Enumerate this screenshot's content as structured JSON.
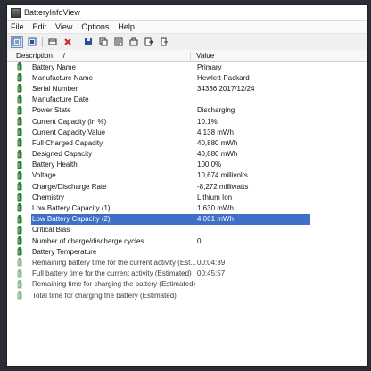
{
  "window": {
    "title": "BatteryInfoView"
  },
  "menu": [
    "File",
    "Edit",
    "View",
    "Options",
    "Help"
  ],
  "toolbar": {
    "icons": [
      "properties-icon",
      "delete-icon",
      "refresh-icon",
      "close-icon",
      "save-icon",
      "copy-icon",
      "report-icon",
      "options-icon",
      "export-icon",
      "exit-icon"
    ]
  },
  "columns": {
    "description": "Description",
    "sort": "/",
    "value": "Value"
  },
  "colors": {
    "selection": "#3f6fc6",
    "battery_green": "#2f7d32"
  },
  "rows": [
    {
      "description": "Battery Name",
      "value": "Primary"
    },
    {
      "description": "Manufacture Name",
      "value": "Hewlett-Packard"
    },
    {
      "description": "Serial Number",
      "value": "34336 2017/12/24"
    },
    {
      "description": "Manufacture Date",
      "value": ""
    },
    {
      "description": "Power State",
      "value": "Discharging"
    },
    {
      "description": "Current Capacity (in %)",
      "value": "10.1%"
    },
    {
      "description": "Current Capacity Value",
      "value": "4,138 mWh"
    },
    {
      "description": "Full Charged Capacity",
      "value": "40,880 mWh"
    },
    {
      "description": "Designed Capacity",
      "value": "40,880 mWh"
    },
    {
      "description": "Battery Health",
      "value": "100.0%"
    },
    {
      "description": "Voltage",
      "value": "10,674 millivolts"
    },
    {
      "description": "Charge/Discharge Rate",
      "value": "-8,272 milliwatts"
    },
    {
      "description": "Chemistry",
      "value": "Lithium Ion"
    },
    {
      "description": "Low Battery Capacity (1)",
      "value": "1,630 mWh"
    },
    {
      "description": "Low Battery Capacity (2)",
      "value": "4,061 mWh"
    },
    {
      "description": "Critical Bias",
      "value": ""
    },
    {
      "description": "Number of charge/discharge cycles",
      "value": "0"
    },
    {
      "description": "Battery Temperature",
      "value": ""
    },
    {
      "description": "Remaining battery time for the current activity (Est...",
      "value": "00:04:39"
    },
    {
      "description": "Full battery time for the current activity (Estimated)",
      "value": "00:45:57"
    },
    {
      "description": "Remaining time for charging the battery (Estimated)",
      "value": ""
    },
    {
      "description": "Total  time for charging the battery (Estimated)",
      "value": ""
    }
  ],
  "selected_row": 14
}
